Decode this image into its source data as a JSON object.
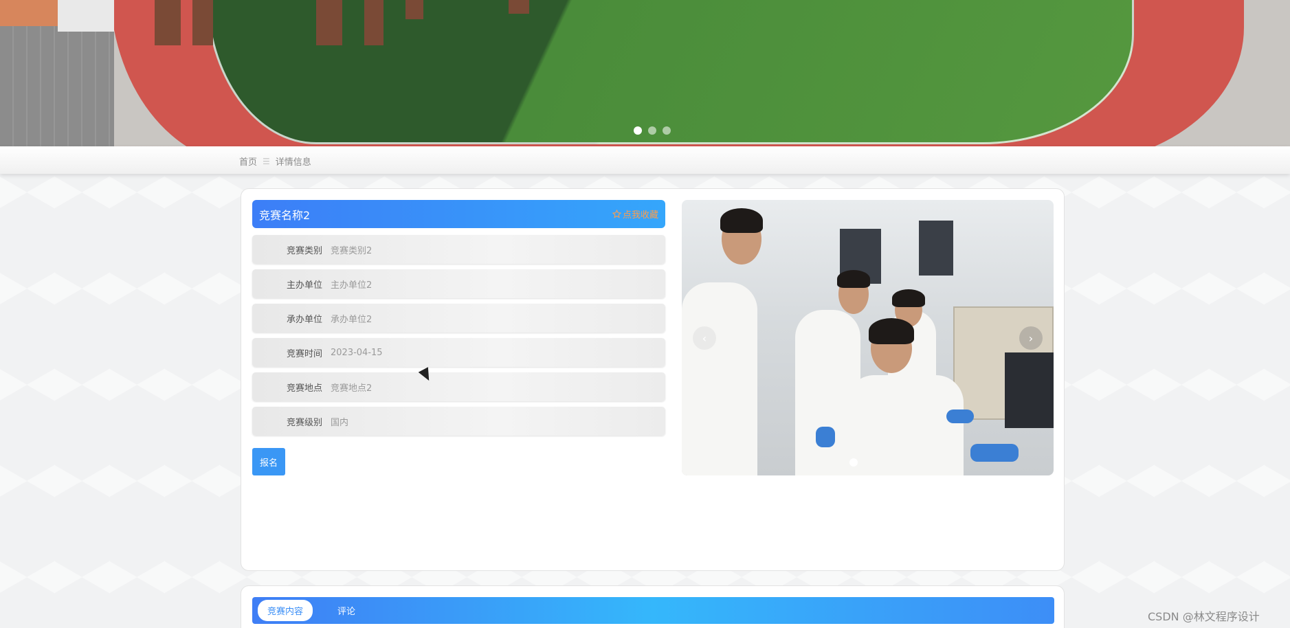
{
  "breadcrumb": {
    "home": "首页",
    "separator": "☰",
    "current": "详情信息"
  },
  "hero": {
    "slide_count": 3,
    "active_slide": 1
  },
  "detail": {
    "title": "竞赛名称2",
    "favorite_label": "点我收藏",
    "favorite_icon": "star-outline-icon",
    "fields": [
      {
        "label": "竞赛类别",
        "value": "竞赛类别2"
      },
      {
        "label": "主办单位",
        "value": "主办单位2"
      },
      {
        "label": "承办单位",
        "value": "承办单位2"
      },
      {
        "label": "竞赛时间",
        "value": "2023-04-15"
      },
      {
        "label": "竞赛地点",
        "value": "竞赛地点2"
      },
      {
        "label": "竞赛级别",
        "value": "国内"
      }
    ],
    "apply_label": "报名"
  },
  "carousel": {
    "prev_icon": "chevron-left-icon",
    "next_icon": "chevron-right-icon",
    "prev_glyph": "‹",
    "next_glyph": "›"
  },
  "tabs": [
    {
      "label": "竞赛内容",
      "active": true
    },
    {
      "label": "评论",
      "active": false
    }
  ],
  "watermark": "CSDN @林文程序设计",
  "colors": {
    "primary": "#3a97f5",
    "accent": "#ff9e4a",
    "title_gradient_start": "#3c7ef7",
    "title_gradient_end": "#35a6fb"
  }
}
